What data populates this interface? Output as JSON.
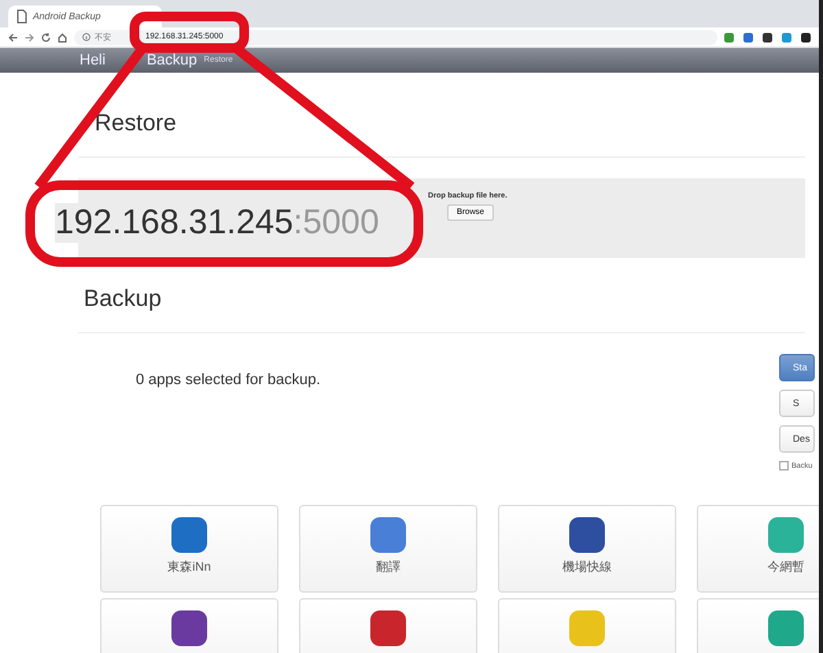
{
  "browser": {
    "tab_title": "Android Backup",
    "security": "不安",
    "url": "192.168.31.245:5000"
  },
  "navbar": {
    "brand": [
      "Heli",
      "Backup"
    ],
    "link": "Restore"
  },
  "restore": {
    "title": "Restore",
    "drop_text": "Drop backup file here.",
    "browse_button": "Browse"
  },
  "backup": {
    "title": "Backup",
    "status": "0 apps selected for backup.",
    "buttons": [
      {
        "label": "Sta",
        "kind": "primary"
      },
      {
        "label": "S",
        "kind": "default"
      },
      {
        "label": "Des",
        "kind": "default"
      }
    ],
    "option": {
      "label": "Backu",
      "checked": false
    }
  },
  "apps": [
    {
      "name": "東森iNn",
      "color": "#1e6fc4"
    },
    {
      "name": "翻譯",
      "color": "#4a7fd8"
    },
    {
      "name": "機場快線",
      "color": "#2e4fa0"
    },
    {
      "name": "今網暫",
      "color": "#2bb39a"
    },
    {
      "color": "#6a3aa0"
    },
    {
      "color": "#c8262c"
    },
    {
      "color": "#e8c21a"
    },
    {
      "color": "#1fa88a"
    }
  ],
  "callout": {
    "host": "192.168.31.245",
    "port": ":5000"
  }
}
